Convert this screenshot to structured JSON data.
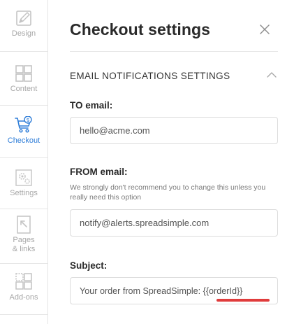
{
  "sidebar": {
    "items": [
      {
        "label": "Design",
        "icon": "design-icon"
      },
      {
        "label": "Content",
        "icon": "content-grid-icon"
      },
      {
        "label": "Checkout",
        "icon": "cart-dollar-icon",
        "active": true
      },
      {
        "label": "Settings",
        "icon": "gears-icon"
      },
      {
        "label": "Pages & links",
        "icon": "pages-links-icon"
      },
      {
        "label": "Add-ons",
        "icon": "add-ons-icon"
      }
    ]
  },
  "panel": {
    "title": "Checkout settings",
    "section_title": "EMAIL NOTIFICATIONS SETTINGS",
    "to_label": "TO email:",
    "to_value": "hello@acme.com",
    "from_label": "FROM email:",
    "from_hint": "We strongly don't recommend you to change this unless you really need this option",
    "from_value": "notify@alerts.spreadsimple.com",
    "subject_label": "Subject:",
    "subject_value": "Your order from SpreadSimple: {{orderId}}"
  },
  "colors": {
    "active": "#2e7dd8",
    "inactive_icon": "#c4c4c4",
    "highlight_underline": "#e03c3c"
  }
}
